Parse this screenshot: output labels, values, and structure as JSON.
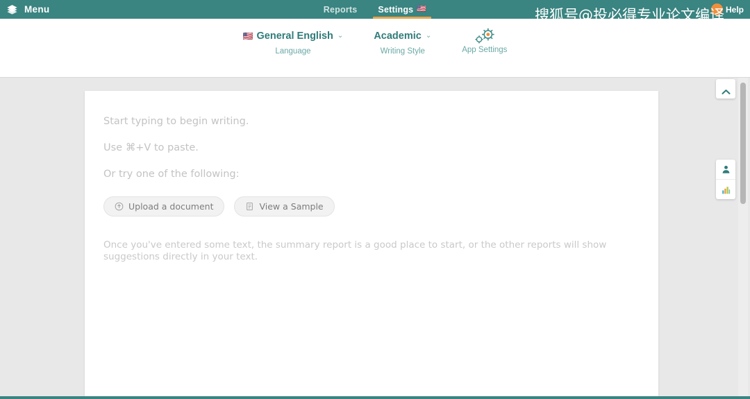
{
  "topbar": {
    "logo_icon": "stack-logo-icon",
    "menu_label": "Menu",
    "nav": [
      {
        "label": "Reports",
        "active": false,
        "flag": ""
      },
      {
        "label": "Settings",
        "active": true,
        "flag": "🇺🇸"
      }
    ],
    "help_label": "Help",
    "help_icon": "help-circle-icon",
    "bg_color": "#3a8481",
    "active_underline_color": "#e8a44f"
  },
  "settings_bar": {
    "items": [
      {
        "value": "General English",
        "label": "Language",
        "flag": "🇺🇸",
        "caret": "⌄",
        "icon": ""
      },
      {
        "value": "Academic",
        "label": "Writing Style",
        "flag": "",
        "caret": "⌄",
        "icon": ""
      },
      {
        "value": "",
        "label": "App Settings",
        "flag": "",
        "caret": "",
        "icon": "gears-icon"
      }
    ],
    "accent_color": "#2f7c79",
    "label_color": "#6aa9a6"
  },
  "editor": {
    "placeholder_lines": [
      "Start typing to begin writing.",
      "Use ⌘+V to paste.",
      "Or try one of the following:"
    ],
    "buttons": [
      {
        "label": "Upload a document",
        "icon": "upload-circle-icon"
      },
      {
        "label": "View a Sample",
        "icon": "document-icon"
      }
    ],
    "hint": "Once you've entered some text, the summary report is a good place to start, or the other reports will show suggestions directly in your text.",
    "placeholder_color": "#c3c3c3"
  },
  "right_rail": {
    "collapse_icon": "chevron-up-icon",
    "buttons": [
      {
        "icon": "person-icon",
        "color": "#2f7c79"
      },
      {
        "icon": "bar-chart-icon",
        "color": "#e8a44f"
      }
    ]
  },
  "watermark": {
    "text": "搜狐号@投必得专业论文编译"
  }
}
